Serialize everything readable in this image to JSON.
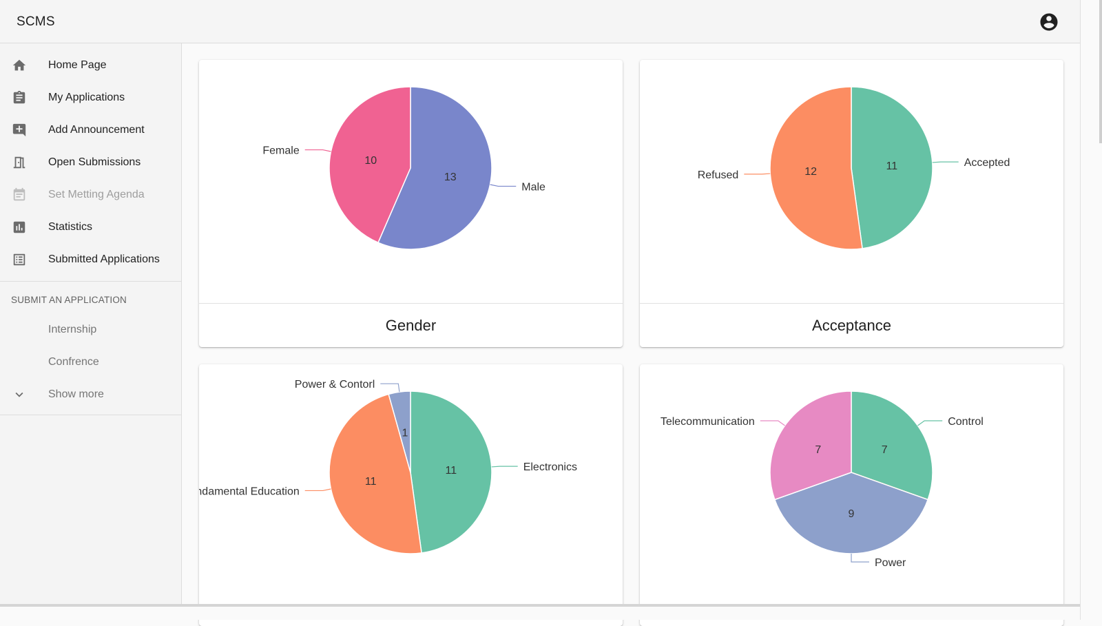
{
  "app": {
    "title": "SCMS"
  },
  "header": {
    "account_icon": "account-circle-icon"
  },
  "sidebar": {
    "items": [
      {
        "label": "Home Page",
        "icon": "home-icon",
        "disabled": false
      },
      {
        "label": "My Applications",
        "icon": "clipboard-icon",
        "disabled": false
      },
      {
        "label": "Add Announcement",
        "icon": "add-comment-icon",
        "disabled": false
      },
      {
        "label": "Open Submissions",
        "icon": "door-open-icon",
        "disabled": false
      },
      {
        "label": "Set Metting Agenda",
        "icon": "calendar-icon",
        "disabled": true
      },
      {
        "label": "Statistics",
        "icon": "bar-chart-icon",
        "disabled": false
      },
      {
        "label": "Submitted Applications",
        "icon": "list-icon",
        "disabled": false
      }
    ],
    "section_title": "SUBMIT AN APPLICATION",
    "section_items": [
      {
        "label": "Internship"
      },
      {
        "label": "Confrence"
      },
      {
        "label": "Show more",
        "icon": "chevron-down-icon"
      }
    ]
  },
  "colors": {
    "blue": "#7986cb",
    "pink": "#f06292",
    "green": "#66c2a5",
    "orange": "#fc8d62",
    "slate": "#8da0cb",
    "magenta": "#e78ac3"
  },
  "chart_data": [
    {
      "type": "pie",
      "title": "Gender",
      "slices": [
        {
          "label": "Male",
          "value": 13,
          "color": "#7986cb"
        },
        {
          "label": "Female",
          "value": 10,
          "color": "#f06292"
        }
      ]
    },
    {
      "type": "pie",
      "title": "Acceptance",
      "slices": [
        {
          "label": "Accepted",
          "value": 11,
          "color": "#66c2a5"
        },
        {
          "label": "Refused",
          "value": 12,
          "color": "#fc8d62"
        }
      ]
    },
    {
      "type": "pie",
      "title": "",
      "slices": [
        {
          "label": "Electronics",
          "value": 11,
          "color": "#66c2a5"
        },
        {
          "label": "Fundamental Education",
          "value": 11,
          "color": "#fc8d62"
        },
        {
          "label": "Power & Contorl",
          "value": 1,
          "color": "#8da0cb"
        }
      ]
    },
    {
      "type": "pie",
      "title": "",
      "slices": [
        {
          "label": "Control",
          "value": 7,
          "color": "#66c2a5"
        },
        {
          "label": "",
          "value": 0,
          "color": "#fc8d62"
        },
        {
          "label": "Power",
          "value": 9,
          "color": "#8da0cb"
        },
        {
          "label": "Telecommunication",
          "value": 7,
          "color": "#e78ac3"
        }
      ]
    }
  ]
}
